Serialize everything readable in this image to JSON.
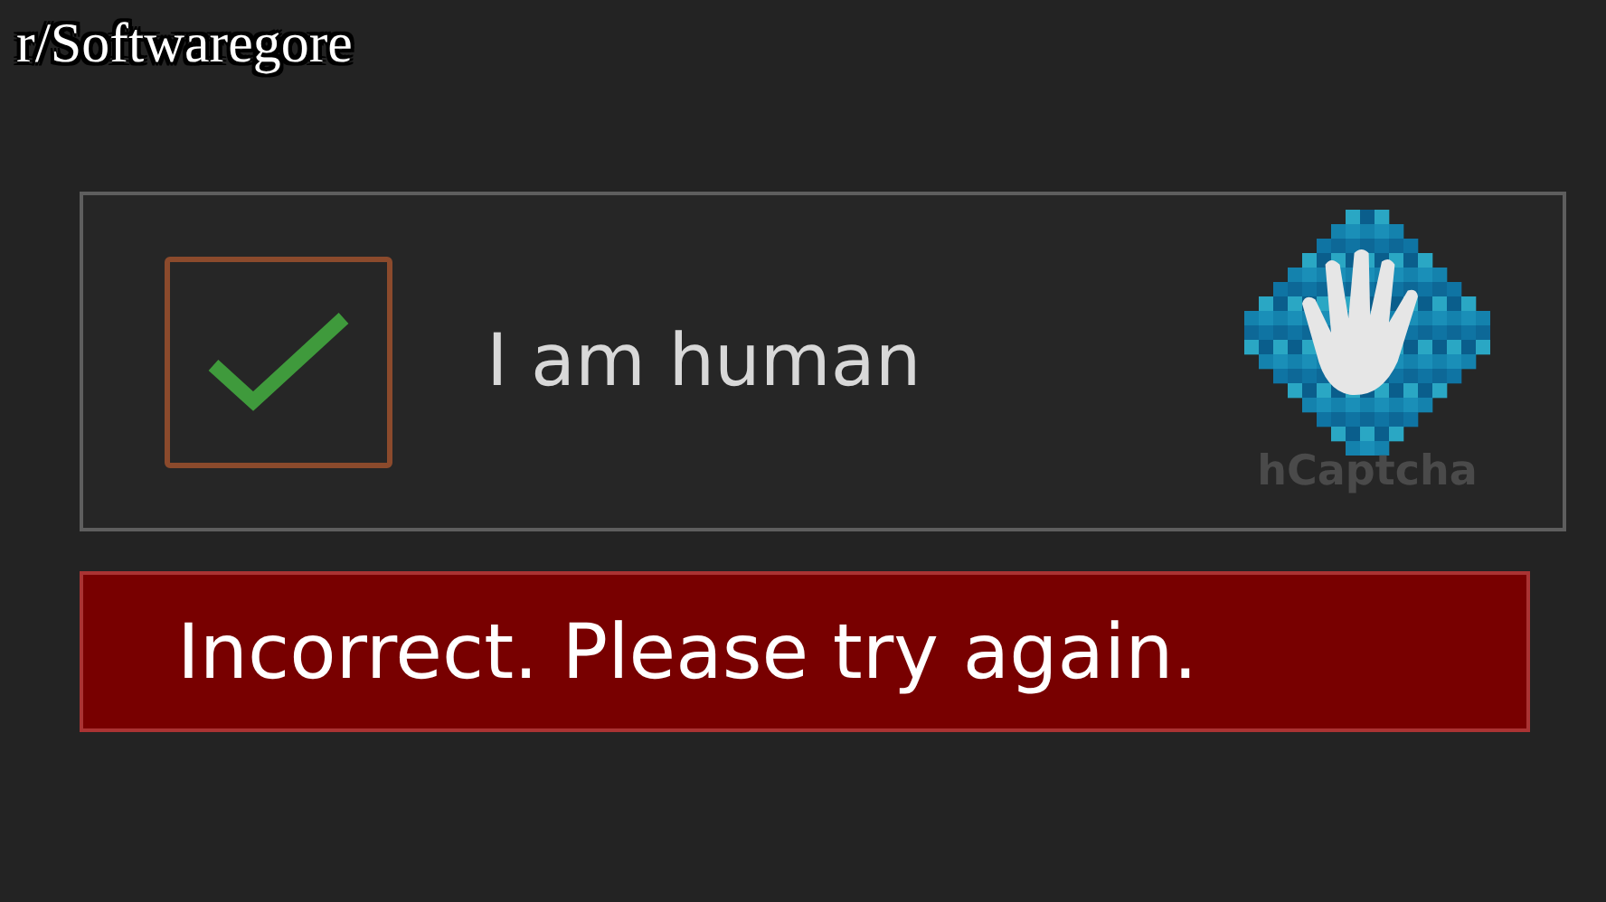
{
  "caption": "r/Softwaregore",
  "captcha": {
    "checked": true,
    "label": "I am human",
    "brand": "hCaptcha"
  },
  "error": {
    "message": "Incorrect. Please try again."
  }
}
